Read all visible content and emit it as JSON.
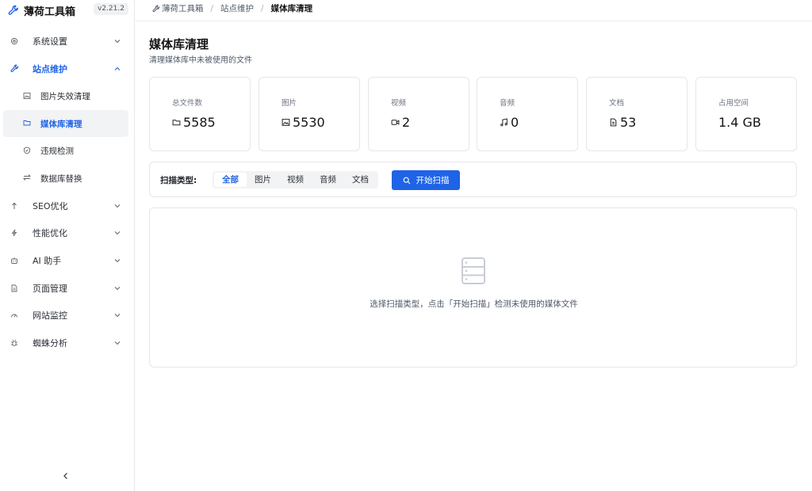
{
  "brand": {
    "name": "薄荷工具箱",
    "version": "v2.21.2",
    "icon": "wrench-icon",
    "accent": "#1f63e6"
  },
  "sidebar": {
    "items": [
      {
        "label": "系统设置",
        "icon": "gear-icon",
        "expanded": false
      },
      {
        "label": "站点维护",
        "icon": "wrench-icon",
        "expanded": true,
        "active": true,
        "children": [
          {
            "label": "图片失效清理",
            "icon": "image-icon"
          },
          {
            "label": "媒体库清理",
            "icon": "folder-icon",
            "selected": true
          },
          {
            "label": "违规检测",
            "icon": "shield-icon"
          },
          {
            "label": "数据库替换",
            "icon": "swap-icon"
          }
        ]
      },
      {
        "label": "SEO优化",
        "icon": "arrow-up-icon",
        "expanded": false
      },
      {
        "label": "性能优化",
        "icon": "lightning-icon",
        "expanded": false
      },
      {
        "label": "AI 助手",
        "icon": "robot-icon",
        "expanded": false
      },
      {
        "label": "页面管理",
        "icon": "page-icon",
        "expanded": false
      },
      {
        "label": "网站监控",
        "icon": "gauge-icon",
        "expanded": false
      },
      {
        "label": "蜘蛛分析",
        "icon": "bug-icon",
        "expanded": false
      }
    ],
    "collapse_icon": "chevron-left-icon"
  },
  "breadcrumb": {
    "root": "薄荷工具箱",
    "section": "站点维护",
    "current": "媒体库清理"
  },
  "page": {
    "title": "媒体库清理",
    "subtitle": "清理媒体库中未被使用的文件"
  },
  "stats": [
    {
      "label": "总文件数",
      "icon": "folder-icon",
      "value": "5585"
    },
    {
      "label": "图片",
      "icon": "image-icon",
      "value": "5530"
    },
    {
      "label": "视频",
      "icon": "video-icon",
      "value": "2"
    },
    {
      "label": "音频",
      "icon": "music-icon",
      "value": "0"
    },
    {
      "label": "文档",
      "icon": "document-icon",
      "value": "53"
    },
    {
      "label": "占用空间",
      "icon": "",
      "value": "1.4 GB"
    }
  ],
  "filter": {
    "label": "扫描类型:",
    "options": [
      "全部",
      "图片",
      "视频",
      "音频",
      "文档"
    ],
    "selected": "全部",
    "scan_button": "开始扫描"
  },
  "empty": {
    "icon": "server-icon",
    "text": "选择扫描类型，点击「开始扫描」检测未使用的媒体文件"
  }
}
